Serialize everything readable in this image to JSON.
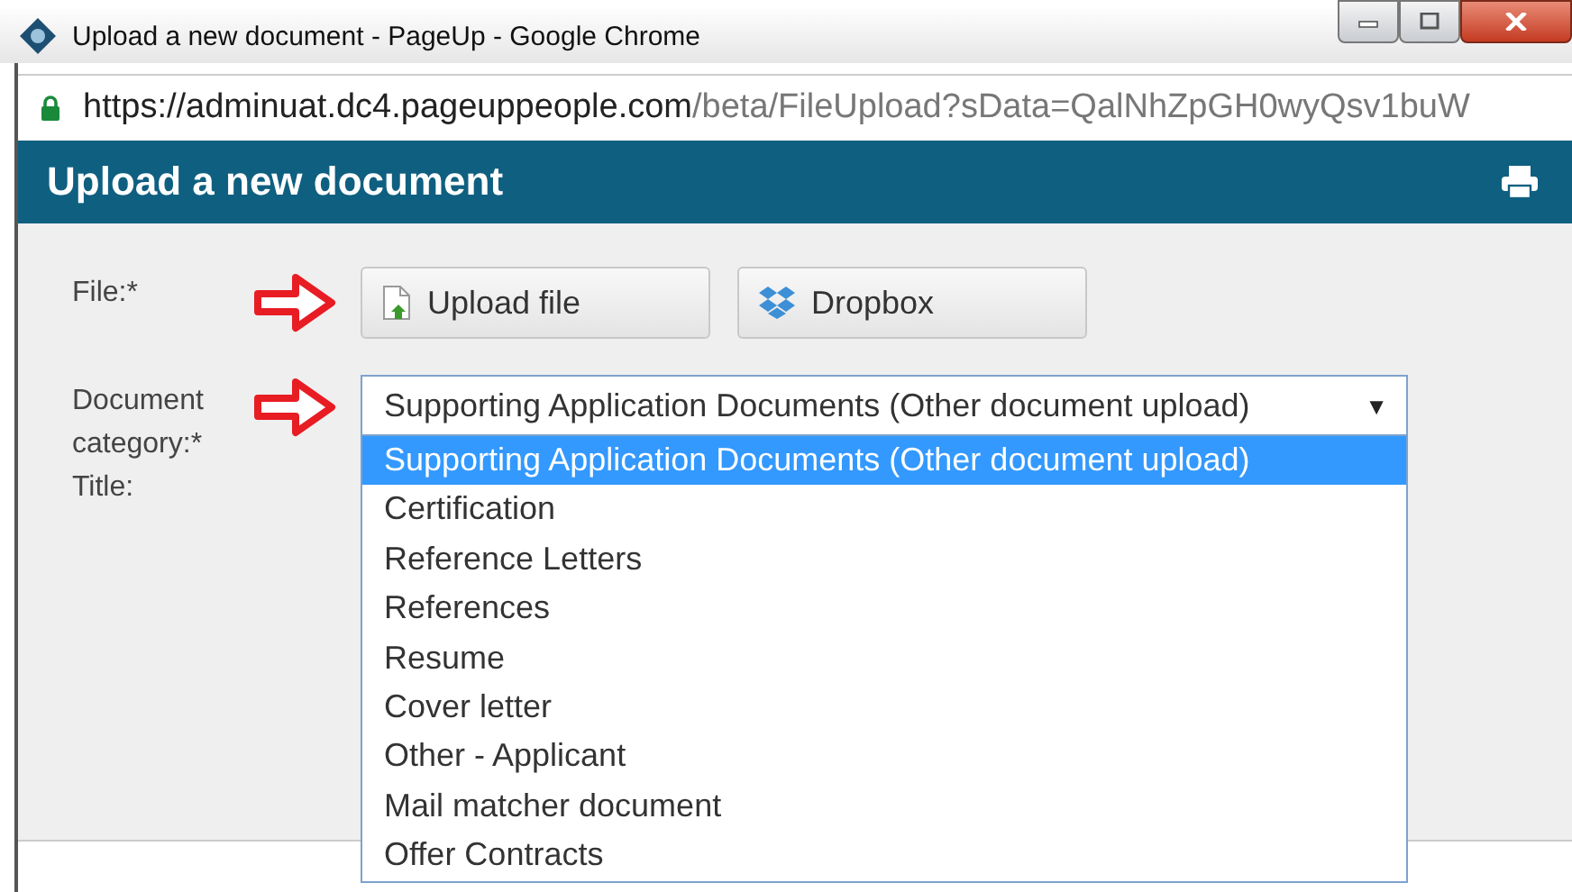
{
  "window": {
    "title": "Upload a new document - PageUp - Google Chrome"
  },
  "address_bar": {
    "host": "https://adminuat.dc4.pageuppeople.com",
    "path": "/beta/FileUpload?sData=QalNhZpGH0wyQsv1buW"
  },
  "header": {
    "title": "Upload a new document"
  },
  "form": {
    "file_label": "File:*",
    "buttons": [
      {
        "label": "Upload file",
        "kind": "upload"
      },
      {
        "label": "Dropbox",
        "kind": "dropbox"
      }
    ],
    "category_label": "Document category:*",
    "category_value": "Supporting Application Documents (Other document upload)",
    "arrow_marker": "▼",
    "title_label": "Title:",
    "options": [
      {
        "label": "Supporting Application Documents (Other document upload)",
        "selected": true
      },
      {
        "label": "Certification",
        "selected": false
      },
      {
        "label": "Reference Letters",
        "selected": false
      },
      {
        "label": "References",
        "selected": false
      },
      {
        "label": "Resume",
        "selected": false
      },
      {
        "label": "Cover letter",
        "selected": false
      },
      {
        "label": "Other - Applicant",
        "selected": false
      },
      {
        "label": "Mail matcher document",
        "selected": false
      },
      {
        "label": "Offer Contracts",
        "selected": false
      }
    ]
  }
}
